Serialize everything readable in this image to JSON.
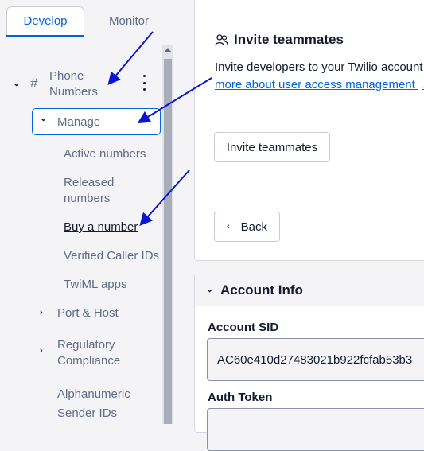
{
  "tabs": {
    "develop": "Develop",
    "monitor": "Monitor"
  },
  "sidebar": {
    "section_icon": "#",
    "section_title_line1": "Phone",
    "section_title_line2": "Numbers",
    "manage": "Manage",
    "items": [
      "Active numbers",
      "Released",
      "numbers",
      "Buy a number",
      "Verified Caller IDs",
      "TwiML apps"
    ],
    "port_host": "Port & Host",
    "regulatory_line1": "Regulatory",
    "regulatory_line2": "Compliance",
    "alpha_line1": "Alphanumeric",
    "alpha_line2": "Sender IDs"
  },
  "invite": {
    "heading": "Invite teammates",
    "description": "Invite developers to your Twilio account",
    "link": "more about user access management",
    "button": "Invite teammates"
  },
  "back_button": "Back",
  "account": {
    "title": "Account Info",
    "sid_label": "Account SID",
    "sid_value": "AC60e410d27483021b922fcfab53b3",
    "token_label": "Auth Token"
  },
  "colors": {
    "accent": "#0263e0",
    "arrow": "#0a14d6"
  },
  "icons": [
    "users-icon",
    "chevron-down-icon",
    "chevron-right-icon",
    "chevron-left-icon",
    "kebab-menu-icon",
    "external-link-icon"
  ]
}
